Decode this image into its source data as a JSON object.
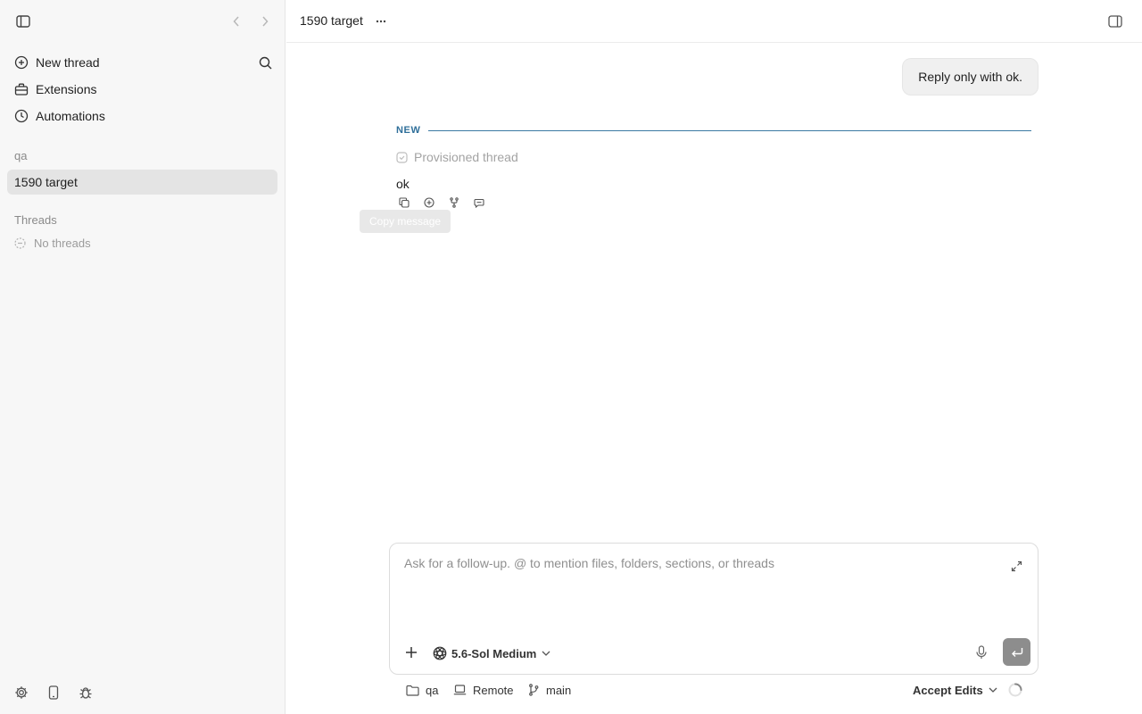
{
  "sidebar": {
    "nav": [
      {
        "label": "New thread",
        "icon": "plus-circle-icon"
      },
      {
        "label": "Extensions",
        "icon": "toolbox-icon"
      },
      {
        "label": "Automations",
        "icon": "clock-icon"
      }
    ],
    "project_section_label": "qa",
    "active_project": "1590 target",
    "threads_label": "Threads",
    "threads_empty": "No threads"
  },
  "topbar": {
    "title": "1590 target"
  },
  "conversation": {
    "user_message": "Reply only with ok.",
    "new_divider_label": "NEW",
    "provisioned_label": "Provisioned thread",
    "assistant_message": "ok",
    "tooltip": "Copy message"
  },
  "composer": {
    "placeholder": "Ask for a follow-up. @ to mention files, folders, sections, or threads",
    "model_label": "5.6-Sol Medium"
  },
  "footer": {
    "folder_label": "qa",
    "env_label": "Remote",
    "branch_label": "main",
    "mode_label": "Accept Edits"
  },
  "colors": {
    "sidebar_bg": "#f7f7f7",
    "active_item_bg": "#e4e4e4",
    "new_divider": "#2f6f9a",
    "send_button": "#8d8d8d"
  }
}
